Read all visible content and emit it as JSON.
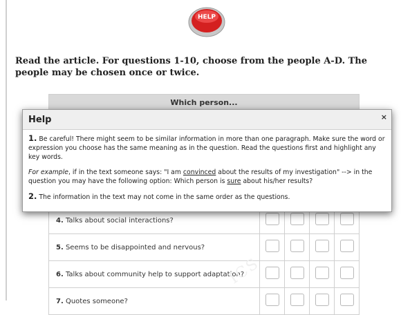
{
  "logo": {
    "text": "HELP",
    "colors": {
      "button": "#d42020",
      "rim": "#b0b0b0"
    }
  },
  "instructions": "Read the article. For questions 1-10, choose from the people A-D. The people may be chosen once or twice.",
  "table": {
    "header": "Which person...",
    "questions": [
      {
        "num": "4.",
        "text": "Talks about social interactions?"
      },
      {
        "num": "5.",
        "text": "Seems to be disappointed and nervous?"
      },
      {
        "num": "6.",
        "text": "Talks about community help to support adaptation?"
      },
      {
        "num": "7.",
        "text": "Quotes someone?"
      }
    ]
  },
  "watermark": "ICS",
  "help_dialog": {
    "title": "Help",
    "close": "×",
    "tip1_num": "1.",
    "tip1_text": "Be careful! There might seem to be similar information in more than one paragraph. Make sure the word or expression you choose has the same meaning as in the question. Read the questions first and highlight any key words.",
    "example_intro": "For example",
    "example_p1": ", if in the text someone says: \"I am ",
    "example_u1": "convinced",
    "example_p2": " about the results of my investigation\" --> in the question you may have the following option: Which person is ",
    "example_u2": "sure",
    "example_p3": " about his/her results?",
    "tip2_num": "2.",
    "tip2_text": "The information in the text may not come in the same order as the questions."
  }
}
